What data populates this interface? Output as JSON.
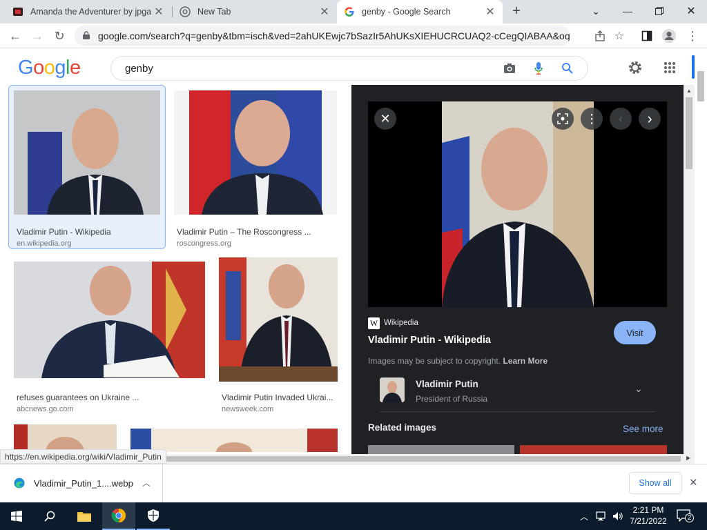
{
  "browser": {
    "tabs": [
      {
        "title": "Amanda the Adventurer by jpga",
        "icon": "game-favicon"
      },
      {
        "title": "New Tab",
        "icon": "chrome-icon"
      },
      {
        "title": "genby - Google Search",
        "icon": "google-g-icon"
      }
    ],
    "new_tab_symbol": "+",
    "url": "google.com/search?q=genby&tbm=isch&ved=2ahUKEwjc7bSazIr5AhUKsXIEHUCRCUAQ2-cCegQIABAA&oq=ge...",
    "status_url": "https://en.wikipedia.org/wiki/Vladimir_Putin"
  },
  "google": {
    "logo": "Google",
    "query": "genby",
    "colors": {
      "blue": "#4285F4",
      "red": "#EA4335",
      "yellow": "#FBBC05",
      "green": "#34A853"
    }
  },
  "results": [
    {
      "title": "Vladimir Putin - Wikipedia",
      "source": "en.wikipedia.org"
    },
    {
      "title": "Vladimir Putin – The Roscongress ...",
      "source": "roscongress.org"
    },
    {
      "title": "refuses guarantees on Ukraine ...",
      "source": "abcnews.go.com"
    },
    {
      "title": "Vladimir Putin Invaded Ukrai...",
      "source": "newsweek.com"
    }
  ],
  "panel": {
    "site": "Wikipedia",
    "site_logo": "W",
    "title": "Vladimir Putin - Wikipedia",
    "visit": "Visit",
    "copyright": "Images may be subject to copyright.",
    "learn_more": "Learn More",
    "entity_name": "Vladimir Putin",
    "entity_desc": "President of Russia",
    "related": "Related images",
    "see_more": "See more"
  },
  "download": {
    "file": "Vladimir_Putin_1....webp",
    "show_all": "Show all"
  },
  "taskbar": {
    "time": "2:21 PM",
    "date": "7/21/2022",
    "notifications": "2"
  }
}
